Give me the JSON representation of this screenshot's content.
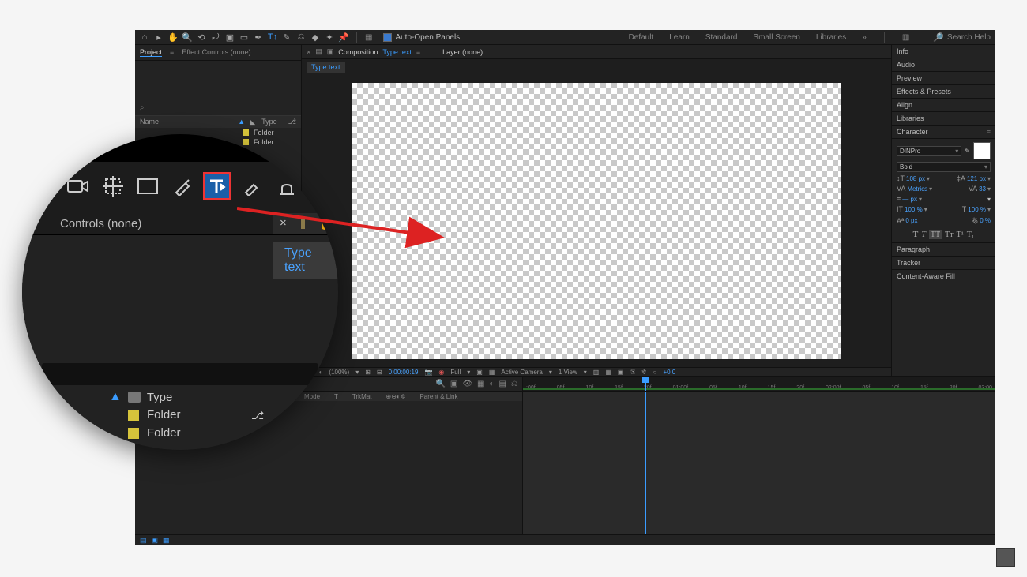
{
  "toolbar": {
    "auto_open": "Auto-Open Panels",
    "workspaces": [
      "Default",
      "Learn",
      "Standard",
      "Small Screen",
      "Libraries"
    ],
    "search_placeholder": "Search Help"
  },
  "left_panel": {
    "tabs": {
      "project": "Project",
      "effect_controls": "Effect Controls (none)"
    },
    "search_icon": "⌕",
    "columns": {
      "name": "Name",
      "type": "Type"
    },
    "rows": [
      {
        "type": "Folder"
      },
      {
        "type": "Folder"
      }
    ]
  },
  "center": {
    "tabs": {
      "composition_label": "Composition",
      "composition_name": "Type text",
      "layer_label": "Layer (none)"
    },
    "sub_tab": "Type text",
    "viewer_bar": {
      "zoom": "(100%)",
      "timecode": "0:00:00:19",
      "res": "Full",
      "camera": "Active Camera",
      "views": "1 View",
      "exposure": "+0,0"
    }
  },
  "right_panels": {
    "info": "Info",
    "audio": "Audio",
    "preview": "Preview",
    "effects": "Effects & Presets",
    "align": "Align",
    "libraries": "Libraries",
    "character": "Character",
    "char": {
      "font": "DINPro",
      "style": "Bold",
      "size": "108 px",
      "leading": "121 px",
      "kerning": "Metrics",
      "tracking": "33",
      "stroke": "— px",
      "vscale": "100 %",
      "hscale": "100 %",
      "baseline": "0 px",
      "tsume": "0 %"
    },
    "paragraph": "Paragraph",
    "tracker": "Tracker",
    "caf": "Content-Aware Fill"
  },
  "timeline": {
    "cols": [
      "Mode",
      "T",
      "TrkMat",
      "Parent & Link"
    ],
    "ruler": [
      ":00f",
      "05f",
      "10f",
      "15f",
      "20f",
      "01:00f",
      "05f",
      "10f",
      "15f",
      "20f",
      "02:00f",
      "05f",
      "10f",
      "15f",
      "20f",
      "03:00"
    ]
  },
  "magnifier": {
    "effect_controls": "Controls (none)",
    "type_text": "Type text",
    "header_type": "Type",
    "folder": "Folder"
  }
}
